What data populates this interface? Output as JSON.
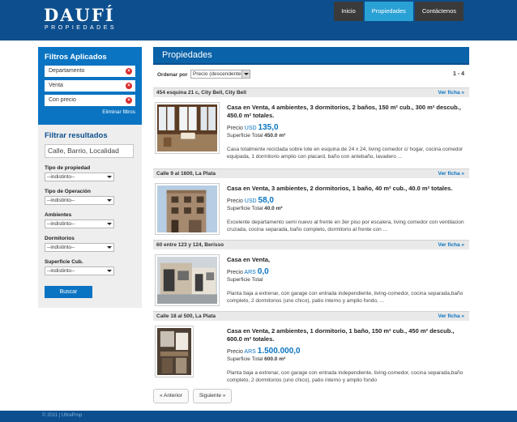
{
  "logo": {
    "main": "DAUFÍ",
    "sub": "PROPIEDADES"
  },
  "nav": [
    {
      "label": "Inicio",
      "active": false
    },
    {
      "label": "Propiedades",
      "active": true
    },
    {
      "label": "Contáctenos",
      "active": false
    }
  ],
  "sidebar": {
    "applied_title": "Filtros Aplicados",
    "applied": [
      "Departamento",
      "Venta",
      "Con precio"
    ],
    "clear_label": "Eliminar filtros",
    "filter_title": "Filtrar resultados",
    "search_placeholder": "Calle, Barrio, Localidad",
    "fields": [
      {
        "label": "Tipo de propiedad",
        "value": "--indistinto--"
      },
      {
        "label": "Tipo de Operación",
        "value": "--indistinto--"
      },
      {
        "label": "Ambientes",
        "value": "--indistinto--"
      },
      {
        "label": "Dormitorios",
        "value": "--indistinto--"
      },
      {
        "label": "Superficie Cub.",
        "value": "--indistinto--"
      }
    ],
    "search_button": "Buscar"
  },
  "main": {
    "title": "Propiedades",
    "sort_label": "Ordenar por",
    "sort_value": "Precio (descendente)",
    "range": "1 - 4",
    "listings": [
      {
        "address": "454 esquina 21 c, City Bell, City Bell",
        "more": "Ver ficha »",
        "title": "Casa en Venta, 4 ambientes, 3 dormitorios, 2 baños, 150 m² cub., 300 m² descub., 450.0 m² totales.",
        "price_label": "Precio",
        "currency": "USD",
        "price": "135,0",
        "sup_label": "Superficie Total",
        "sup_value": "450.0 m²",
        "desc": "Casa totalmente reciclada sobre lote en esquina de 24 x 24, living comedor c/ hogar, cocina comedor equipada, 1 dormitorio amplio con placard, baño con antebaño, lavadero ..."
      },
      {
        "address": "Calle 9 al 1600, La Plata",
        "more": "Ver ficha »",
        "title": "Casa en Venta, 3 ambientes, 2 dormitorios, 1 baño, 40 m² cub., 40.0 m² totales.",
        "price_label": "Precio",
        "currency": "USD",
        "price": "58,0",
        "sup_label": "Superficie Total",
        "sup_value": "40.0 m²",
        "desc": "Excelente departamento semi nuevo al frente en 3er piso por escalera, living comedor con ventilacion cruzada, cocina separada, baño completo, dormitorio al frente con ..."
      },
      {
        "address": "60 entre 123 y 124, Berisso",
        "more": "Ver ficha »",
        "title": "Casa en Venta,",
        "price_label": "Precio",
        "currency": "ARS",
        "price": "0,0",
        "sup_label": "Superficie Total",
        "sup_value": "",
        "desc": "Planta baja a extrenar, con garage con entrada independiente, living-comedor, cocina separada,baño completo, 2 dormitorios (uno chico), patio interno y amplio fondo, ..."
      },
      {
        "address": "Calle 18 al 500, La Plata",
        "more": "Ver ficha »",
        "title": "Casa en Venta, 2 ambientes, 1 dormitorio, 1 baño, 150 m² cub., 450 m² descub., 600.0 m² totales.",
        "price_label": "Precio",
        "currency": "ARS",
        "price": "1.500.000,0",
        "sup_label": "Superficie Total",
        "sup_value": "600.0 m²",
        "desc": "Planta baja a extrenar, con garage con entrada independiente, living-comedor, cocina separada,baño completo, 2 dormitorios (uno chico), patio interno y amplio fondo"
      }
    ],
    "prev": "« Anterior",
    "next": "Siguiente »"
  },
  "footer": "© 2011 | UltraProp"
}
